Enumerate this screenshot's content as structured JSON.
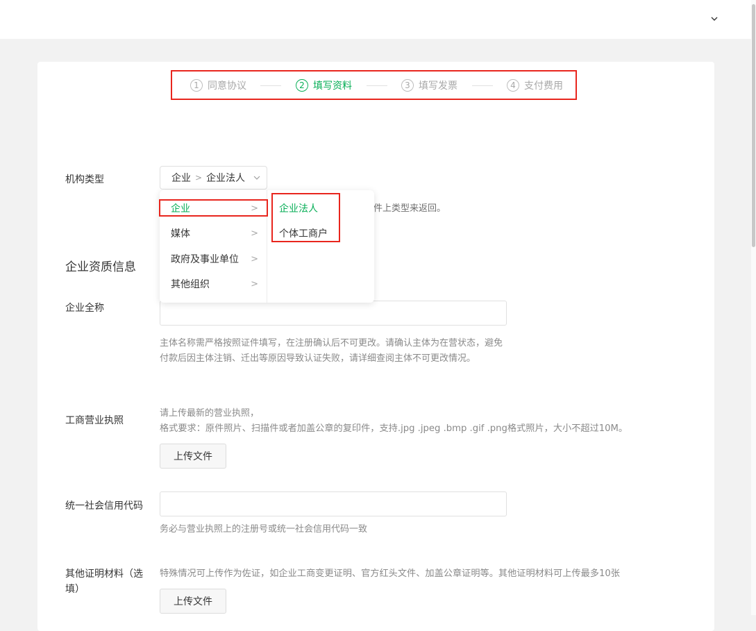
{
  "steps": [
    {
      "num": "1",
      "label": "同意协议"
    },
    {
      "num": "2",
      "label": "填写资料"
    },
    {
      "num": "3",
      "label": "填写发票"
    },
    {
      "num": "4",
      "label": "支付费用"
    }
  ],
  "form": {
    "org_type": {
      "label": "机构类型",
      "selected_level1": "企业",
      "separator": ">",
      "selected_level2": "企业法人"
    },
    "hint_partial": "件上类型来返回。",
    "dropdown": {
      "level1": [
        {
          "label": "企业",
          "arrow": ">"
        },
        {
          "label": "媒体",
          "arrow": ">"
        },
        {
          "label": "政府及事业单位",
          "arrow": ">"
        },
        {
          "label": "其他组织",
          "arrow": ">"
        }
      ],
      "level2": [
        "企业法人",
        "个体工商户"
      ]
    },
    "section_title": "企业资质信息",
    "company_name": {
      "label": "企业全称",
      "value": "",
      "desc": "主体名称需严格按照证件填写，在注册确认后不可更改。请确认主体为在营状态，避免付款后因主体注销、迁出等原因导致认证失败，请详细查阅主体不可更改情况。"
    },
    "license": {
      "label": "工商营业执照",
      "desc1": "请上传最新的营业执照，",
      "desc2": "格式要求：原件照片、扫描件或者加盖公章的复印件，支持.jpg .jpeg .bmp .gif .png格式照片，大小不超过10M。",
      "upload_label": "上传文件"
    },
    "credit_code": {
      "label": "统一社会信用代码",
      "value": "",
      "desc": "务必与营业执照上的注册号或统一社会信用代码一致"
    },
    "other": {
      "label_line1": "其他证明材料（选",
      "label_line2": "填）",
      "desc": "特殊情况可上传作为佐证，如企业工商变更证明、官方红头文件、加盖公章证明等。其他证明材料可上传最多10张",
      "upload_label": "上传文件"
    }
  },
  "colors": {
    "accent": "#06ae56",
    "annotation": "#e8251d"
  }
}
